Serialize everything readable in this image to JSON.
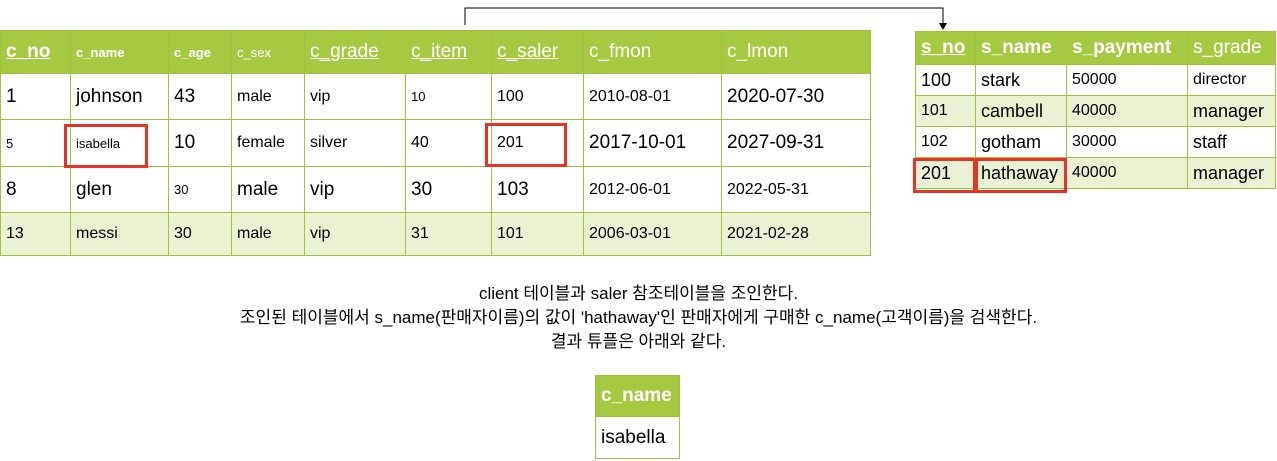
{
  "client": {
    "headers": [
      "c_no",
      "c_name",
      "c_age",
      "c_sex",
      "c_grade",
      "c_item",
      "c_saler",
      "c_fmon",
      "c_lmon"
    ],
    "rows": [
      [
        "1",
        "johnson",
        "43",
        "male",
        "vip",
        "10",
        "100",
        "2010-08-01",
        "2020-07-30"
      ],
      [
        "5",
        "isabella",
        "10",
        "female",
        "silver",
        "40",
        "201",
        "2017-10-01",
        "2027-09-31"
      ],
      [
        "8",
        "glen",
        "30",
        "male",
        "vip",
        "30",
        "103",
        "2012-06-01",
        "2022-05-31"
      ],
      [
        "13",
        "messi",
        "30",
        "male",
        "vip",
        "31",
        "101",
        "2006-03-01",
        "2021-02-28"
      ]
    ]
  },
  "saler": {
    "headers": [
      "s_no",
      "s_name",
      "s_payment",
      "s_grade"
    ],
    "rows": [
      [
        "100",
        "stark",
        "50000",
        "director"
      ],
      [
        "101",
        "cambell",
        "40000",
        "manager"
      ],
      [
        "102",
        "gotham",
        "30000",
        "staff"
      ],
      [
        "201",
        "hathaway",
        "40000",
        "manager"
      ]
    ]
  },
  "description": [
    "client 테이블과 saler 참조테이블을 조인한다.",
    "조인된 테이블에서 s_name(판매자이름)의 값이 'hathaway'인 판매자에게  구매한 c_name(고객이름)을 검색한다.",
    "결과 튜플은 아래와 같다."
  ],
  "result": {
    "header": "c_name",
    "value": "isabella"
  },
  "colors": {
    "header_bg": "#a7c942",
    "alt_row_bg": "#eaf2d3",
    "highlight": "#e8332a"
  }
}
